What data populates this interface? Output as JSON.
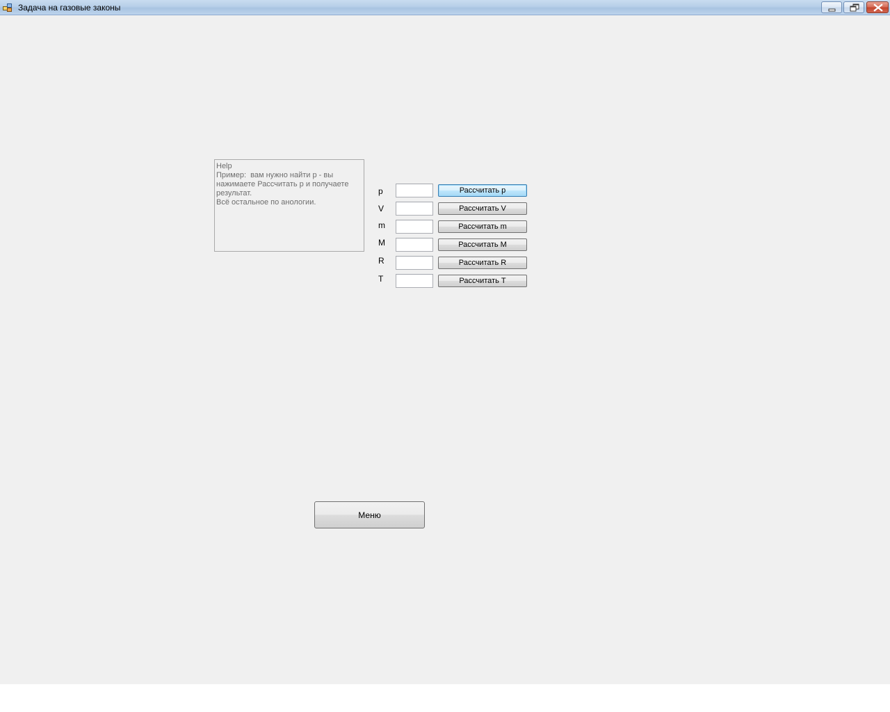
{
  "window": {
    "title": "Задача на газовые законы",
    "icon": "app-window-icon",
    "controls": {
      "minimize_icon": "minimize-icon",
      "restore_icon": "restore-icon",
      "close_icon": "close-icon"
    }
  },
  "help": {
    "text": "Help\nПример:  вам нужно найти p - вы нажимаете Рассчитать p и получаете результат.\nВсё остальное по анологии."
  },
  "variables": [
    {
      "label": "p",
      "value": "",
      "button": "Рассчитать p"
    },
    {
      "label": "V",
      "value": "",
      "button": "Рассчитать V"
    },
    {
      "label": "m",
      "value": "",
      "button": "Рассчитать m"
    },
    {
      "label": "M",
      "value": "",
      "button": "Рассчитать M"
    },
    {
      "label": "R",
      "value": "",
      "button": "Рассчитать R"
    },
    {
      "label": "T",
      "value": "",
      "button": "Рассчитать T"
    }
  ],
  "menu": {
    "label": "Меню"
  }
}
